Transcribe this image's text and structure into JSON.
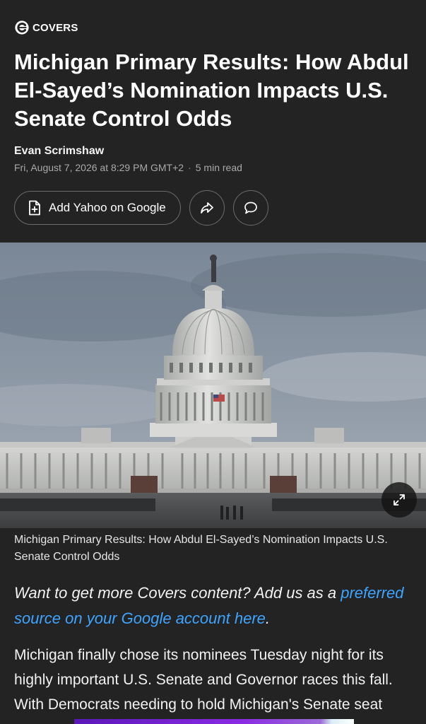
{
  "brand": {
    "name": "COVERS"
  },
  "article": {
    "headline": "Michigan Primary Results: How Abdul El-Sayed’s Nomination Impacts U.S. Senate Control Odds",
    "author": "Evan Scrimshaw",
    "date": "Fri, August 7, 2026 at 8:29 PM GMT+2",
    "separator": "·",
    "read_time": "5 min read"
  },
  "actions": {
    "add_google_label": "Add Yahoo on Google",
    "share_icon": "share-arrow-icon",
    "comment_icon": "comment-bubble-icon"
  },
  "hero": {
    "subject": "US Capitol building under overcast sky",
    "caption": "Michigan Primary Results: How Abdul El-Sayed’s Nomination Impacts U.S. Senate Control Odds",
    "expand_icon": "expand-icon"
  },
  "promo": {
    "text": "Want to get more Covers content? Add us as a ",
    "link_text": "preferred source on your Google account here",
    "trailing": "."
  },
  "body": {
    "paragraph_1": "Michigan finally chose its nominees Tuesday night for its highly important U.S. Senate and Governor races this fall. With Democrats needing to hold Michigan's Senate seat"
  },
  "colors": {
    "background": "#232323",
    "link": "#3ea4ff",
    "border": "#6b6b6b"
  }
}
